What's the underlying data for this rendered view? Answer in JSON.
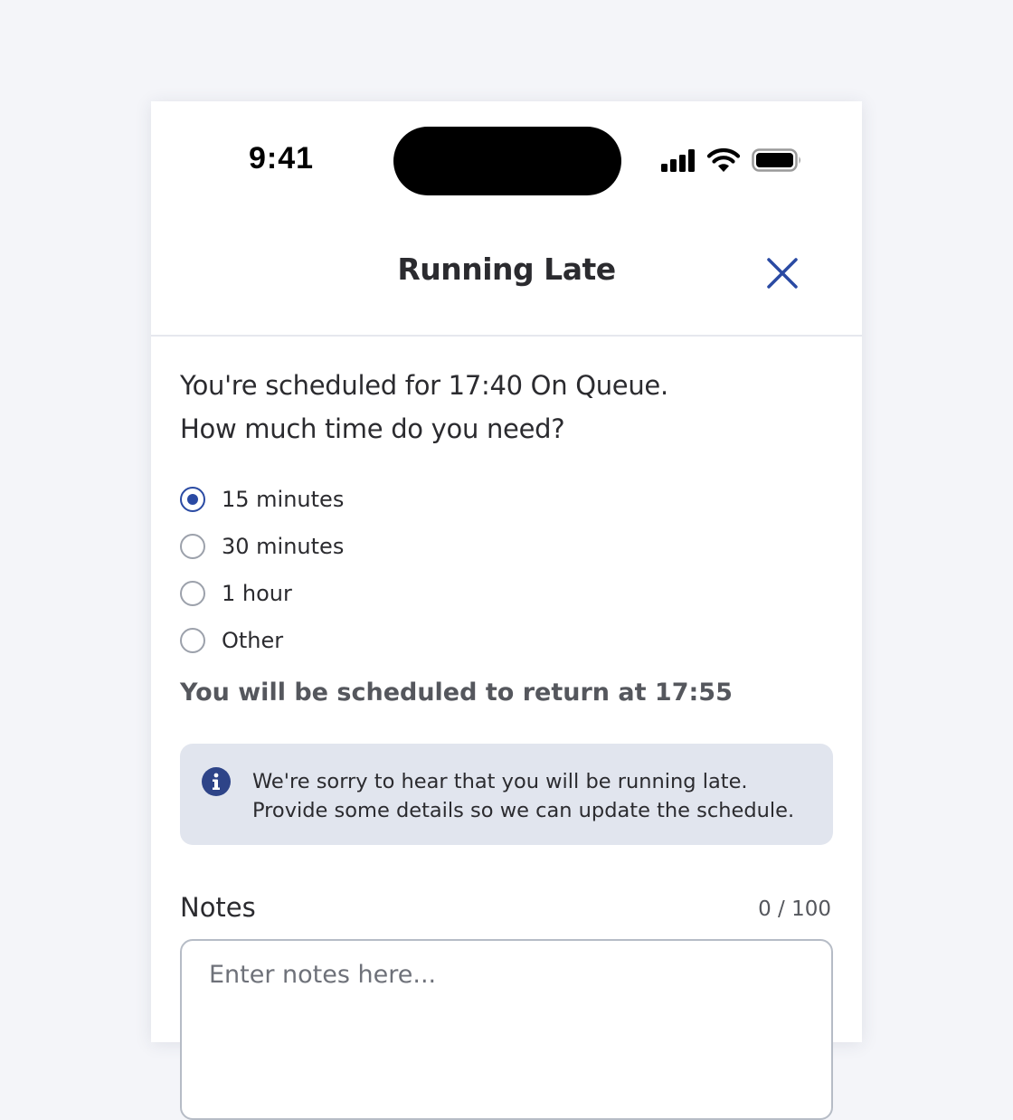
{
  "status_bar": {
    "time": "9:41",
    "icons": [
      "cellular-signal-icon",
      "wifi-icon",
      "battery-icon"
    ]
  },
  "header": {
    "title": "Running Late",
    "close_icon": "close-icon"
  },
  "question": {
    "line1": "You're scheduled for 17:40 On Queue.",
    "line2": "How much time do you need?"
  },
  "options": [
    {
      "label": "15 minutes",
      "selected": true
    },
    {
      "label": "30 minutes",
      "selected": false
    },
    {
      "label": "1 hour",
      "selected": false
    },
    {
      "label": "Other",
      "selected": false
    }
  ],
  "return_message": "You will be scheduled to return at 17:55",
  "info": {
    "icon": "info-icon",
    "line1": "We're sorry to hear that you will be running late.",
    "line2": "Provide some details so we can update the schedule."
  },
  "notes": {
    "label": "Notes",
    "counter": "0 / 100",
    "placeholder": "Enter notes here...",
    "value": ""
  },
  "colors": {
    "accent": "#2a4aa3",
    "background": "#f4f5f9",
    "info_background": "#e1e5ee",
    "text": "#2b2b2f",
    "muted_text": "#55575d"
  }
}
